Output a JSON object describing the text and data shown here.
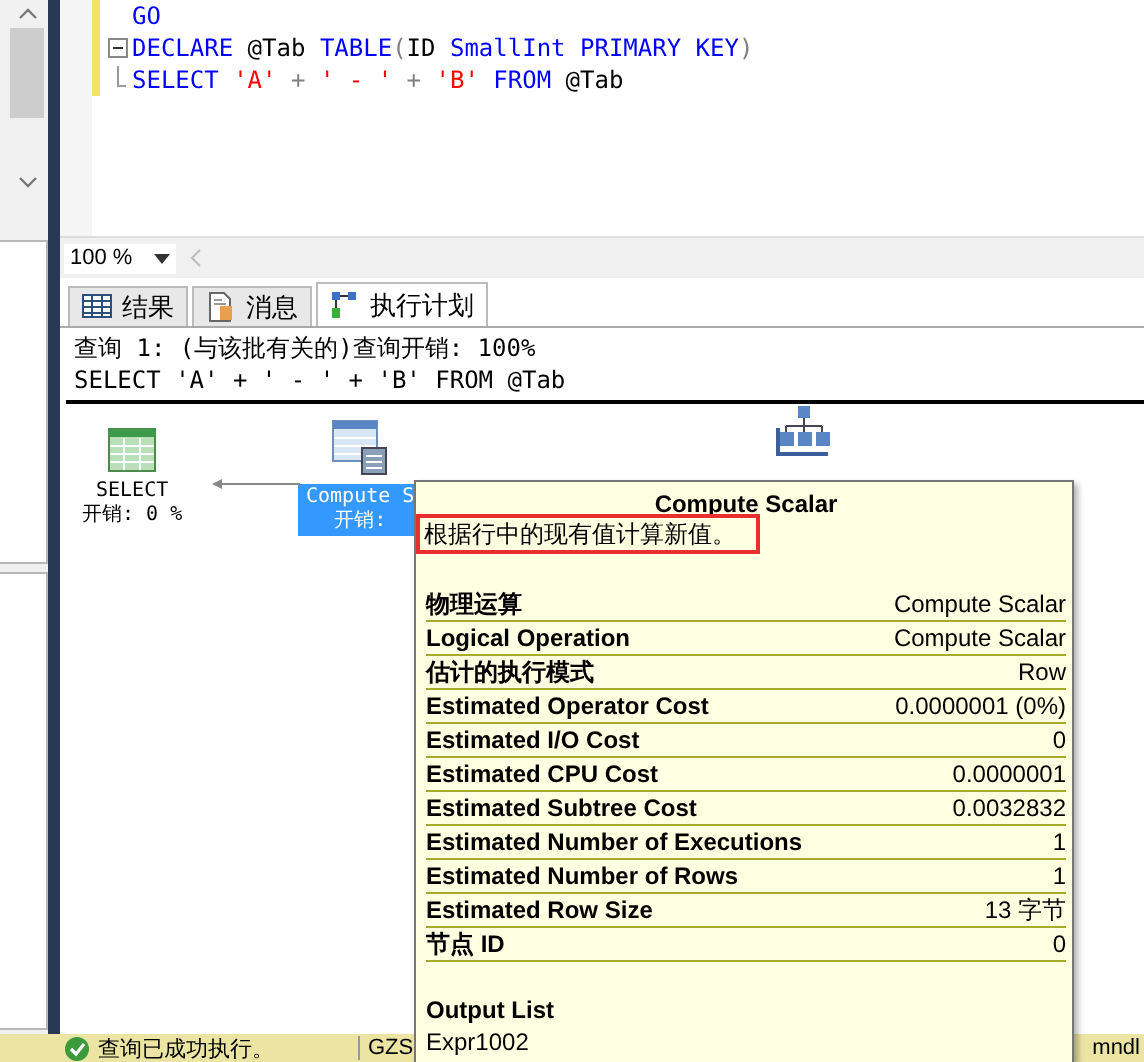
{
  "editor": {
    "lines": [
      [
        {
          "kind": "keyword",
          "text": "GO"
        }
      ],
      [
        {
          "kind": "keyword",
          "text": "DECLARE"
        },
        {
          "kind": "plain",
          "text": " @Tab "
        },
        {
          "kind": "keyword",
          "text": "TABLE"
        },
        {
          "kind": "operator",
          "text": "("
        },
        {
          "kind": "plain",
          "text": "ID "
        },
        {
          "kind": "keyword",
          "text": "SmallInt PRIMARY KEY"
        },
        {
          "kind": "operator",
          "text": ")"
        }
      ],
      [
        {
          "kind": "keyword",
          "text": "SELECT"
        },
        {
          "kind": "string",
          "text": " 'A'"
        },
        {
          "kind": "operator",
          "text": " + "
        },
        {
          "kind": "string",
          "text": "' - '"
        },
        {
          "kind": "operator",
          "text": " + "
        },
        {
          "kind": "string",
          "text": "'B'"
        },
        {
          "kind": "keyword",
          "text": " FROM"
        },
        {
          "kind": "plain",
          "text": " @Tab"
        }
      ]
    ]
  },
  "zoom": {
    "value": "100 %"
  },
  "tabs": [
    {
      "label": "结果",
      "kind": "grid",
      "selected": false
    },
    {
      "label": "消息",
      "kind": "doc",
      "selected": false
    },
    {
      "label": "执行计划",
      "kind": "plan",
      "selected": true
    }
  ],
  "plan": {
    "header": "查询 1: (与该批有关的)查询开销: 100%",
    "query": "SELECT 'A' + ' - ' + 'B' FROM @Tab",
    "nodes": [
      {
        "kind": "select",
        "name": "SELECT",
        "cost": "开销: 0 %",
        "selected": false
      },
      {
        "kind": "compute",
        "name": "Compute S",
        "cost": "开销:",
        "selected": true
      },
      {
        "kind": "scan",
        "selected": false
      }
    ]
  },
  "tooltip": {
    "title": "Compute Scalar",
    "description": "根据行中的现有值计算新值。",
    "highlighted": true,
    "rows": [
      {
        "label": "物理运算",
        "value": "Compute Scalar"
      },
      {
        "label": "Logical Operation",
        "value": "Compute Scalar"
      },
      {
        "label": "估计的执行模式",
        "value": "Row"
      },
      {
        "label": "Estimated Operator Cost",
        "value": "0.0000001 (0%)"
      },
      {
        "label": "Estimated I/O Cost",
        "value": "0"
      },
      {
        "label": "Estimated CPU Cost",
        "value": "0.0000001"
      },
      {
        "label": "Estimated Subtree Cost",
        "value": "0.0032832"
      },
      {
        "label": "Estimated Number of Executions",
        "value": "1"
      },
      {
        "label": "Estimated Number of Rows",
        "value": "1"
      },
      {
        "label": "Estimated Row Size",
        "value": "13 字节"
      },
      {
        "label": "节点 ID",
        "value": "0"
      }
    ],
    "output_heading": "Output List",
    "output_value": "Expr1002"
  },
  "status_bar": {
    "message": "查询已成功执行。",
    "server": "GZS",
    "user": "mndl"
  }
}
